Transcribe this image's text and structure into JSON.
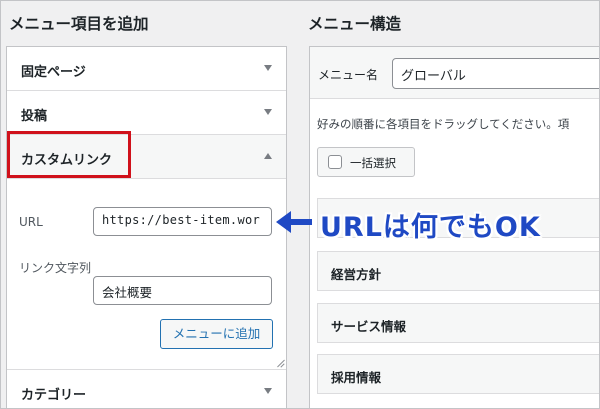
{
  "left_panel": {
    "title": "メニュー項目を追加",
    "sections": [
      {
        "label": "固定ページ",
        "state": "collapsed"
      },
      {
        "label": "投稿",
        "state": "collapsed"
      },
      {
        "label": "カスタムリンク",
        "state": "expanded"
      },
      {
        "label": "カテゴリー",
        "state": "collapsed"
      }
    ],
    "custom_link": {
      "url_label": "URL",
      "url_value": "https://best-item.wor",
      "link_text_label": "リンク文字列",
      "link_text_value": "会社概要",
      "add_button_label": "メニューに追加"
    }
  },
  "right_panel": {
    "title": "メニュー構造",
    "menu_name_label": "メニュー名",
    "menu_name_value": "グローバル",
    "instructions": "好みの順番に各項目をドラッグしてください。項",
    "bulk_select_label": "一括選択",
    "menu_items": [
      {
        "label": ""
      },
      {
        "label": "経営方針"
      },
      {
        "label": "サービス情報"
      },
      {
        "label": "採用情報"
      }
    ]
  },
  "annotation": {
    "text": "URLは何でもOK",
    "color": "#1f49c4"
  },
  "colors": {
    "highlight": "#d0111b",
    "primary": "#2271b1"
  }
}
